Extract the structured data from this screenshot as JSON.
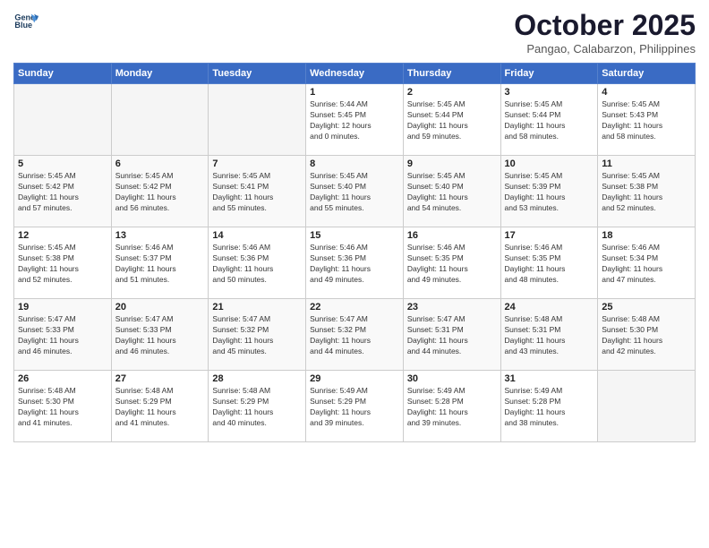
{
  "header": {
    "logo_line1": "General",
    "logo_line2": "Blue",
    "month": "October 2025",
    "location": "Pangao, Calabarzon, Philippines"
  },
  "weekdays": [
    "Sunday",
    "Monday",
    "Tuesday",
    "Wednesday",
    "Thursday",
    "Friday",
    "Saturday"
  ],
  "weeks": [
    [
      {
        "day": "",
        "info": ""
      },
      {
        "day": "",
        "info": ""
      },
      {
        "day": "",
        "info": ""
      },
      {
        "day": "1",
        "info": "Sunrise: 5:44 AM\nSunset: 5:45 PM\nDaylight: 12 hours\nand 0 minutes."
      },
      {
        "day": "2",
        "info": "Sunrise: 5:45 AM\nSunset: 5:44 PM\nDaylight: 11 hours\nand 59 minutes."
      },
      {
        "day": "3",
        "info": "Sunrise: 5:45 AM\nSunset: 5:44 PM\nDaylight: 11 hours\nand 58 minutes."
      },
      {
        "day": "4",
        "info": "Sunrise: 5:45 AM\nSunset: 5:43 PM\nDaylight: 11 hours\nand 58 minutes."
      }
    ],
    [
      {
        "day": "5",
        "info": "Sunrise: 5:45 AM\nSunset: 5:42 PM\nDaylight: 11 hours\nand 57 minutes."
      },
      {
        "day": "6",
        "info": "Sunrise: 5:45 AM\nSunset: 5:42 PM\nDaylight: 11 hours\nand 56 minutes."
      },
      {
        "day": "7",
        "info": "Sunrise: 5:45 AM\nSunset: 5:41 PM\nDaylight: 11 hours\nand 55 minutes."
      },
      {
        "day": "8",
        "info": "Sunrise: 5:45 AM\nSunset: 5:40 PM\nDaylight: 11 hours\nand 55 minutes."
      },
      {
        "day": "9",
        "info": "Sunrise: 5:45 AM\nSunset: 5:40 PM\nDaylight: 11 hours\nand 54 minutes."
      },
      {
        "day": "10",
        "info": "Sunrise: 5:45 AM\nSunset: 5:39 PM\nDaylight: 11 hours\nand 53 minutes."
      },
      {
        "day": "11",
        "info": "Sunrise: 5:45 AM\nSunset: 5:38 PM\nDaylight: 11 hours\nand 52 minutes."
      }
    ],
    [
      {
        "day": "12",
        "info": "Sunrise: 5:45 AM\nSunset: 5:38 PM\nDaylight: 11 hours\nand 52 minutes."
      },
      {
        "day": "13",
        "info": "Sunrise: 5:46 AM\nSunset: 5:37 PM\nDaylight: 11 hours\nand 51 minutes."
      },
      {
        "day": "14",
        "info": "Sunrise: 5:46 AM\nSunset: 5:36 PM\nDaylight: 11 hours\nand 50 minutes."
      },
      {
        "day": "15",
        "info": "Sunrise: 5:46 AM\nSunset: 5:36 PM\nDaylight: 11 hours\nand 49 minutes."
      },
      {
        "day": "16",
        "info": "Sunrise: 5:46 AM\nSunset: 5:35 PM\nDaylight: 11 hours\nand 49 minutes."
      },
      {
        "day": "17",
        "info": "Sunrise: 5:46 AM\nSunset: 5:35 PM\nDaylight: 11 hours\nand 48 minutes."
      },
      {
        "day": "18",
        "info": "Sunrise: 5:46 AM\nSunset: 5:34 PM\nDaylight: 11 hours\nand 47 minutes."
      }
    ],
    [
      {
        "day": "19",
        "info": "Sunrise: 5:47 AM\nSunset: 5:33 PM\nDaylight: 11 hours\nand 46 minutes."
      },
      {
        "day": "20",
        "info": "Sunrise: 5:47 AM\nSunset: 5:33 PM\nDaylight: 11 hours\nand 46 minutes."
      },
      {
        "day": "21",
        "info": "Sunrise: 5:47 AM\nSunset: 5:32 PM\nDaylight: 11 hours\nand 45 minutes."
      },
      {
        "day": "22",
        "info": "Sunrise: 5:47 AM\nSunset: 5:32 PM\nDaylight: 11 hours\nand 44 minutes."
      },
      {
        "day": "23",
        "info": "Sunrise: 5:47 AM\nSunset: 5:31 PM\nDaylight: 11 hours\nand 44 minutes."
      },
      {
        "day": "24",
        "info": "Sunrise: 5:48 AM\nSunset: 5:31 PM\nDaylight: 11 hours\nand 43 minutes."
      },
      {
        "day": "25",
        "info": "Sunrise: 5:48 AM\nSunset: 5:30 PM\nDaylight: 11 hours\nand 42 minutes."
      }
    ],
    [
      {
        "day": "26",
        "info": "Sunrise: 5:48 AM\nSunset: 5:30 PM\nDaylight: 11 hours\nand 41 minutes."
      },
      {
        "day": "27",
        "info": "Sunrise: 5:48 AM\nSunset: 5:29 PM\nDaylight: 11 hours\nand 41 minutes."
      },
      {
        "day": "28",
        "info": "Sunrise: 5:48 AM\nSunset: 5:29 PM\nDaylight: 11 hours\nand 40 minutes."
      },
      {
        "day": "29",
        "info": "Sunrise: 5:49 AM\nSunset: 5:29 PM\nDaylight: 11 hours\nand 39 minutes."
      },
      {
        "day": "30",
        "info": "Sunrise: 5:49 AM\nSunset: 5:28 PM\nDaylight: 11 hours\nand 39 minutes."
      },
      {
        "day": "31",
        "info": "Sunrise: 5:49 AM\nSunset: 5:28 PM\nDaylight: 11 hours\nand 38 minutes."
      },
      {
        "day": "",
        "info": ""
      }
    ]
  ]
}
